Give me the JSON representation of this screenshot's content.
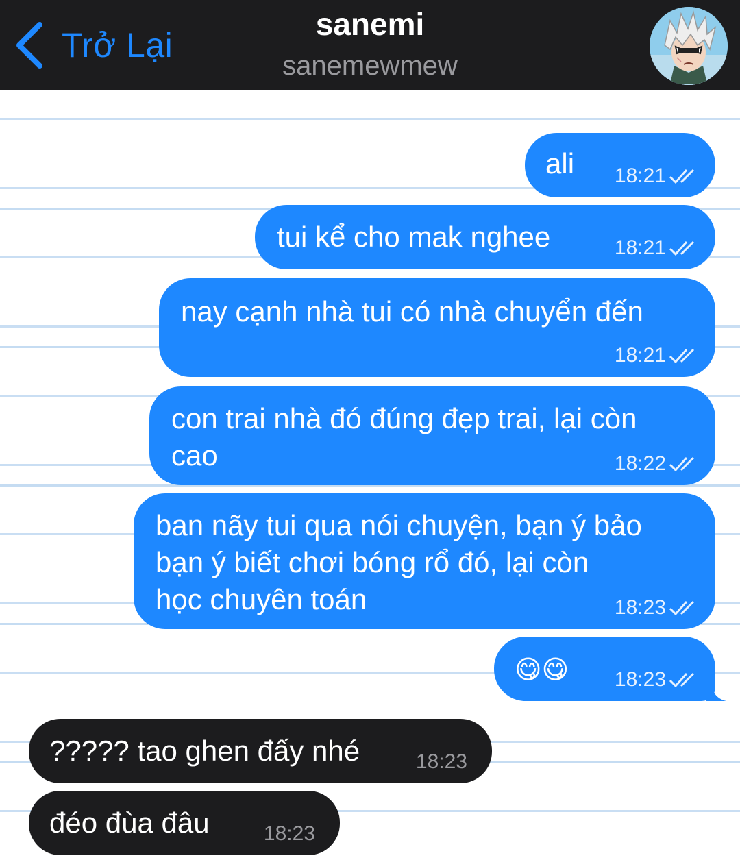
{
  "header": {
    "back_label": "Trở Lại",
    "title": "sanemi",
    "subtitle": "sanemewmew",
    "back_icon": "chevron-left-icon",
    "avatar_icon": "avatar-image",
    "accent": "#1e88ff",
    "bar_color": "#1c1c1e"
  },
  "messages": [
    {
      "direction": "outgoing",
      "lines": [
        "ali"
      ],
      "time": "18:21",
      "status": "read"
    },
    {
      "direction": "outgoing",
      "lines": [
        "tui kể cho mak nghee"
      ],
      "time": "18:21",
      "status": "read"
    },
    {
      "direction": "outgoing",
      "lines": [
        "nay cạnh nhà tui có nhà chuyển đến"
      ],
      "time": "18:21",
      "status": "read"
    },
    {
      "direction": "outgoing",
      "lines": [
        "con trai nhà đó đúng đẹp trai, lại còn",
        "cao"
      ],
      "time": "18:22",
      "status": "read"
    },
    {
      "direction": "outgoing",
      "lines": [
        "ban nãy tui qua nói chuyện, bạn ý bảo",
        "bạn ý biết chơi bóng rổ đó, lại còn",
        "học chuyên toán"
      ],
      "time": "18:23",
      "status": "read"
    },
    {
      "direction": "outgoing",
      "lines": [
        "😋😋"
      ],
      "time": "18:23",
      "status": "read"
    },
    {
      "direction": "incoming",
      "lines": [
        "????? tao ghen đấy nhé"
      ],
      "time": "18:23"
    },
    {
      "direction": "incoming",
      "lines": [
        "đéo đùa đâu"
      ],
      "time": "18:23"
    }
  ],
  "colors": {
    "outgoing_bubble": "#1e88ff",
    "incoming_bubble": "#1c1c1e",
    "ruled_line": "#c9def3"
  }
}
